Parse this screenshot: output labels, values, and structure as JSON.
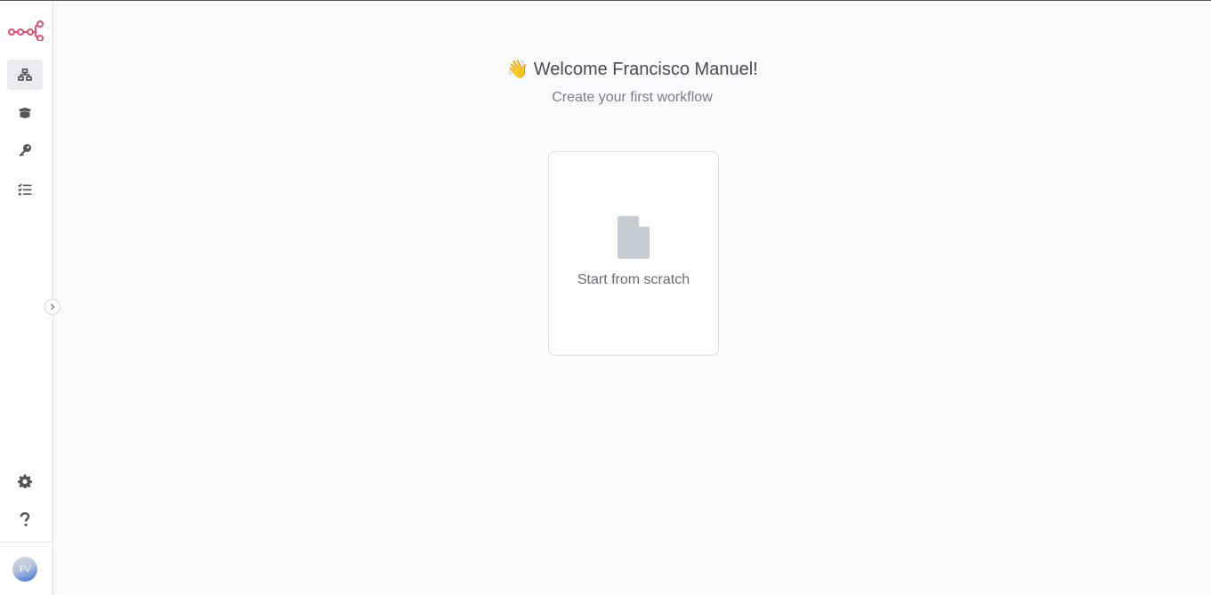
{
  "sidebar": {
    "logo_icon": "n8n-logo-icon",
    "brand_color": "#ea4b71",
    "items": [
      {
        "name": "workflows",
        "icon": "network-icon",
        "active": true
      },
      {
        "name": "templates",
        "icon": "box-open-icon",
        "active": false
      },
      {
        "name": "credentials",
        "icon": "key-icon",
        "active": false
      },
      {
        "name": "executions",
        "icon": "tasks-icon",
        "active": false
      }
    ],
    "bottom_items": [
      {
        "name": "settings",
        "icon": "gear-icon"
      },
      {
        "name": "help",
        "icon": "question-icon"
      }
    ],
    "collapse_icon": "chevron-right-icon",
    "user_initials": "FV"
  },
  "main": {
    "welcome_emoji": "👋",
    "welcome_text": "Welcome Francisco Manuel!",
    "subtitle": "Create your first workflow",
    "card": {
      "icon": "file-icon",
      "label": "Start from scratch"
    }
  }
}
